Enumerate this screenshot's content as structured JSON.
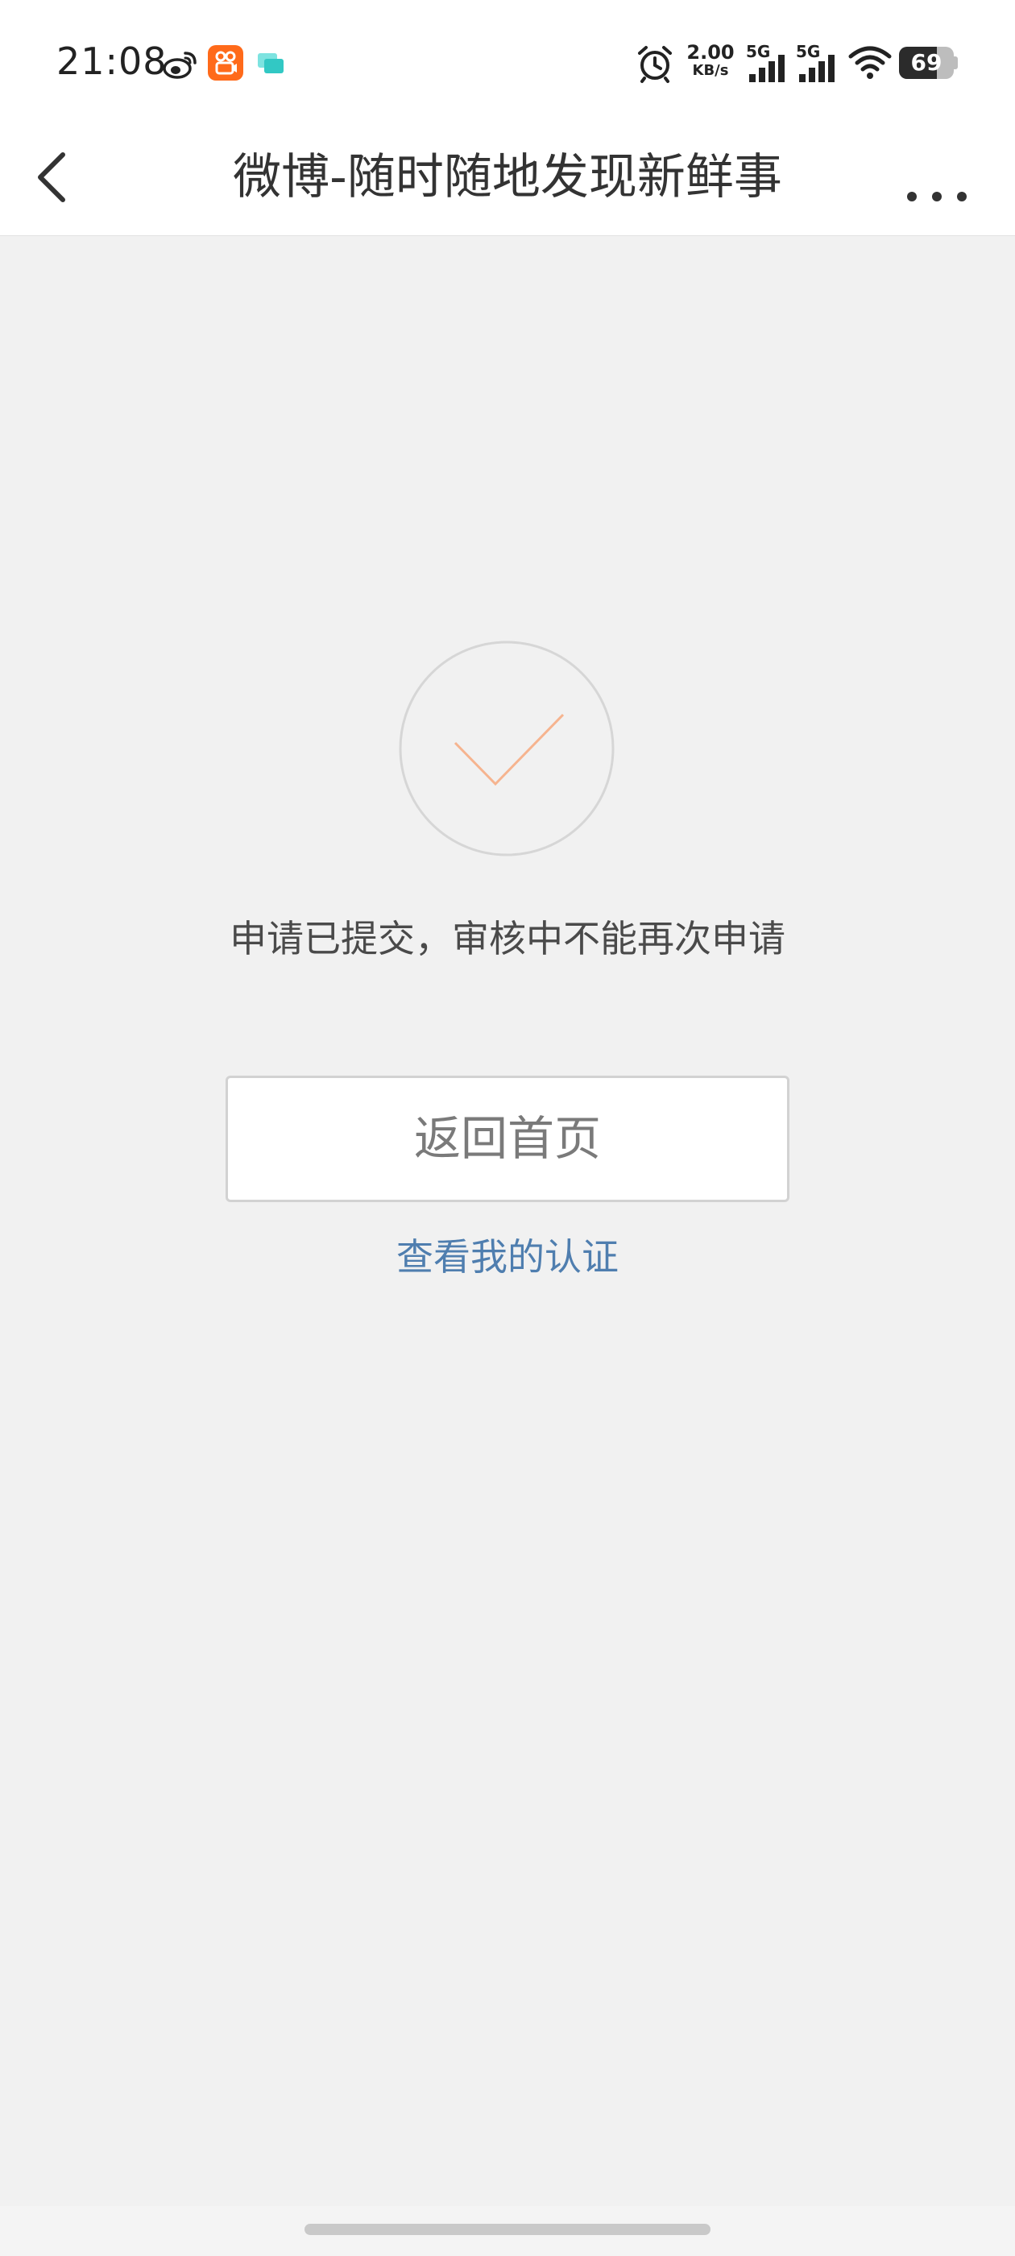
{
  "status_bar": {
    "time": "21:08",
    "net_speed_value": "2.00",
    "net_speed_unit": "KB/s",
    "signal1_label": "5G",
    "signal2_label": "5G",
    "battery_level": "69",
    "icons": [
      "weibo-icon",
      "kuaishou-icon",
      "chat-app-icon",
      "alarm-icon",
      "signal-icon",
      "wifi-icon",
      "battery-icon"
    ]
  },
  "nav": {
    "title": "微博-随时随地发现新鲜事",
    "back_icon": "chevron-left-icon",
    "more_icon": "more-dots-icon"
  },
  "main": {
    "status_icon": "check-circle-icon",
    "message": "申请已提交，审核中不能再次申请",
    "home_button_label": "返回首页",
    "cert_link_label": "查看我的认证"
  },
  "colors": {
    "background": "#f1f1f1",
    "check_mark": "#f6b48f",
    "link": "#4f7eaf",
    "weibo_orange": "#ff6a1a"
  }
}
